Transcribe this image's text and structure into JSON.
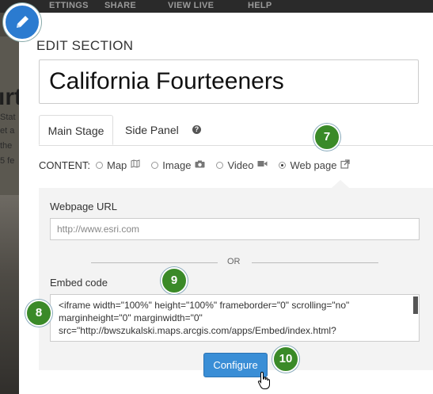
{
  "topbar": {
    "items": [
      "ETTINGS",
      "SHARE",
      "VIEW LIVE",
      "HELP"
    ]
  },
  "background": {
    "heading_fragment": "ırt",
    "text_lines": [
      "Stat",
      "et a",
      "the",
      "5 fe"
    ]
  },
  "modal": {
    "title": "EDIT SECTION",
    "section_title": "California Fourteeners",
    "tabs": [
      "Main Stage",
      "Side Panel"
    ],
    "help_icon": "?",
    "content_label": "CONTENT:",
    "options": [
      {
        "label": "Map",
        "icon": "map-icon",
        "checked": false
      },
      {
        "label": "Image",
        "icon": "camera-icon",
        "checked": false
      },
      {
        "label": "Video",
        "icon": "video-icon",
        "checked": false
      },
      {
        "label": "Web page",
        "icon": "external-link-icon",
        "checked": true
      }
    ],
    "webpage_url_label": "Webpage URL",
    "webpage_url_placeholder": "http://www.esri.com",
    "or_text": "OR",
    "embed_label": "Embed code",
    "embed_lines": [
      "<iframe width=\"100%\" height=\"100%\" frameborder=\"0\" scrolling=\"no\"",
      "marginheight=\"0\" marginwidth=\"0\"",
      "src=\"http://bwszukalski.maps.arcgis.com/apps/Embed/index.html?"
    ],
    "configure_label": "Configure"
  },
  "steps": [
    "7",
    "8",
    "9",
    "10"
  ],
  "colors": {
    "step_badge": "#3a8a28",
    "accent_button": "#3a8ed6",
    "pencil_badge": "#2b7bd0"
  }
}
